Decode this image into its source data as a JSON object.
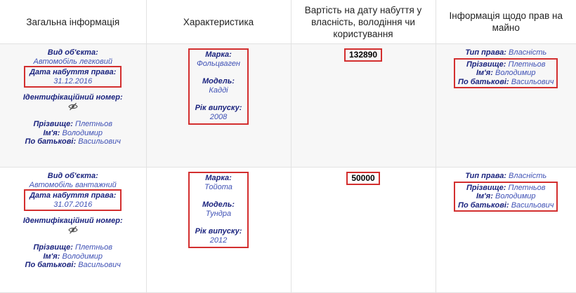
{
  "headers": [
    "Загальна інформація",
    "Характеристика",
    "Вартість на дату набуття у власність, володіння чи користування",
    "Інформація щодо прав на майно"
  ],
  "rows": [
    {
      "general": {
        "object_type_label": "Вид об'єкта:",
        "object_type_value": "Автомобіль легковий",
        "acq_date_label": "Дата набуття права:",
        "acq_date_value": "31.12.2016",
        "id_label": "Ідентифікаційний номер:",
        "surname_label": "Прізвище:",
        "surname_value": "Плетньов",
        "name_label": "Ім'я:",
        "name_value": "Володимир",
        "patronymic_label": "По батькові:",
        "patronymic_value": "Васильович"
      },
      "characteristics": {
        "brand_label": "Марка:",
        "brand_value": "Фольцваген",
        "model_label": "Модель:",
        "model_value": "Кадді",
        "year_label": "Рік випуску:",
        "year_value": "2008"
      },
      "value": "132890",
      "rights": {
        "right_type_label": "Тип права:",
        "right_type_value": "Власність",
        "surname_label": "Прізвище:",
        "surname_value": "Плетньов",
        "name_label": "Ім'я:",
        "name_value": "Володимир",
        "patronymic_label": "По батькові:",
        "patronymic_value": "Васильович"
      }
    },
    {
      "general": {
        "object_type_label": "Вид об'єкта:",
        "object_type_value": "Автомобіль вантажний",
        "acq_date_label": "Дата набуття права:",
        "acq_date_value": "31.07.2016",
        "id_label": "Ідентифікаційний номер:",
        "surname_label": "Прізвище:",
        "surname_value": "Плетньов",
        "name_label": "Ім'я:",
        "name_value": "Володимир",
        "patronymic_label": "По батькові:",
        "patronymic_value": "Васильович"
      },
      "characteristics": {
        "brand_label": "Марка:",
        "brand_value": "Тойота",
        "model_label": "Модель:",
        "model_value": "Тундра",
        "year_label": "Рік випуску:",
        "year_value": "2012"
      },
      "value": "50000",
      "rights": {
        "right_type_label": "Тип права:",
        "right_type_value": "Власність",
        "surname_label": "Прізвище:",
        "surname_value": "Плетньов",
        "name_label": "Ім'я:",
        "name_value": "Володимир",
        "patronymic_label": "По батькові:",
        "patronymic_value": "Васильович"
      }
    }
  ],
  "icons": {
    "hidden_id": "eye-slash-icon"
  },
  "colors": {
    "label": "#1a237e",
    "value": "#3f51b5",
    "highlight_box": "#d32f2f",
    "row_shade": "#f7f7f7"
  }
}
